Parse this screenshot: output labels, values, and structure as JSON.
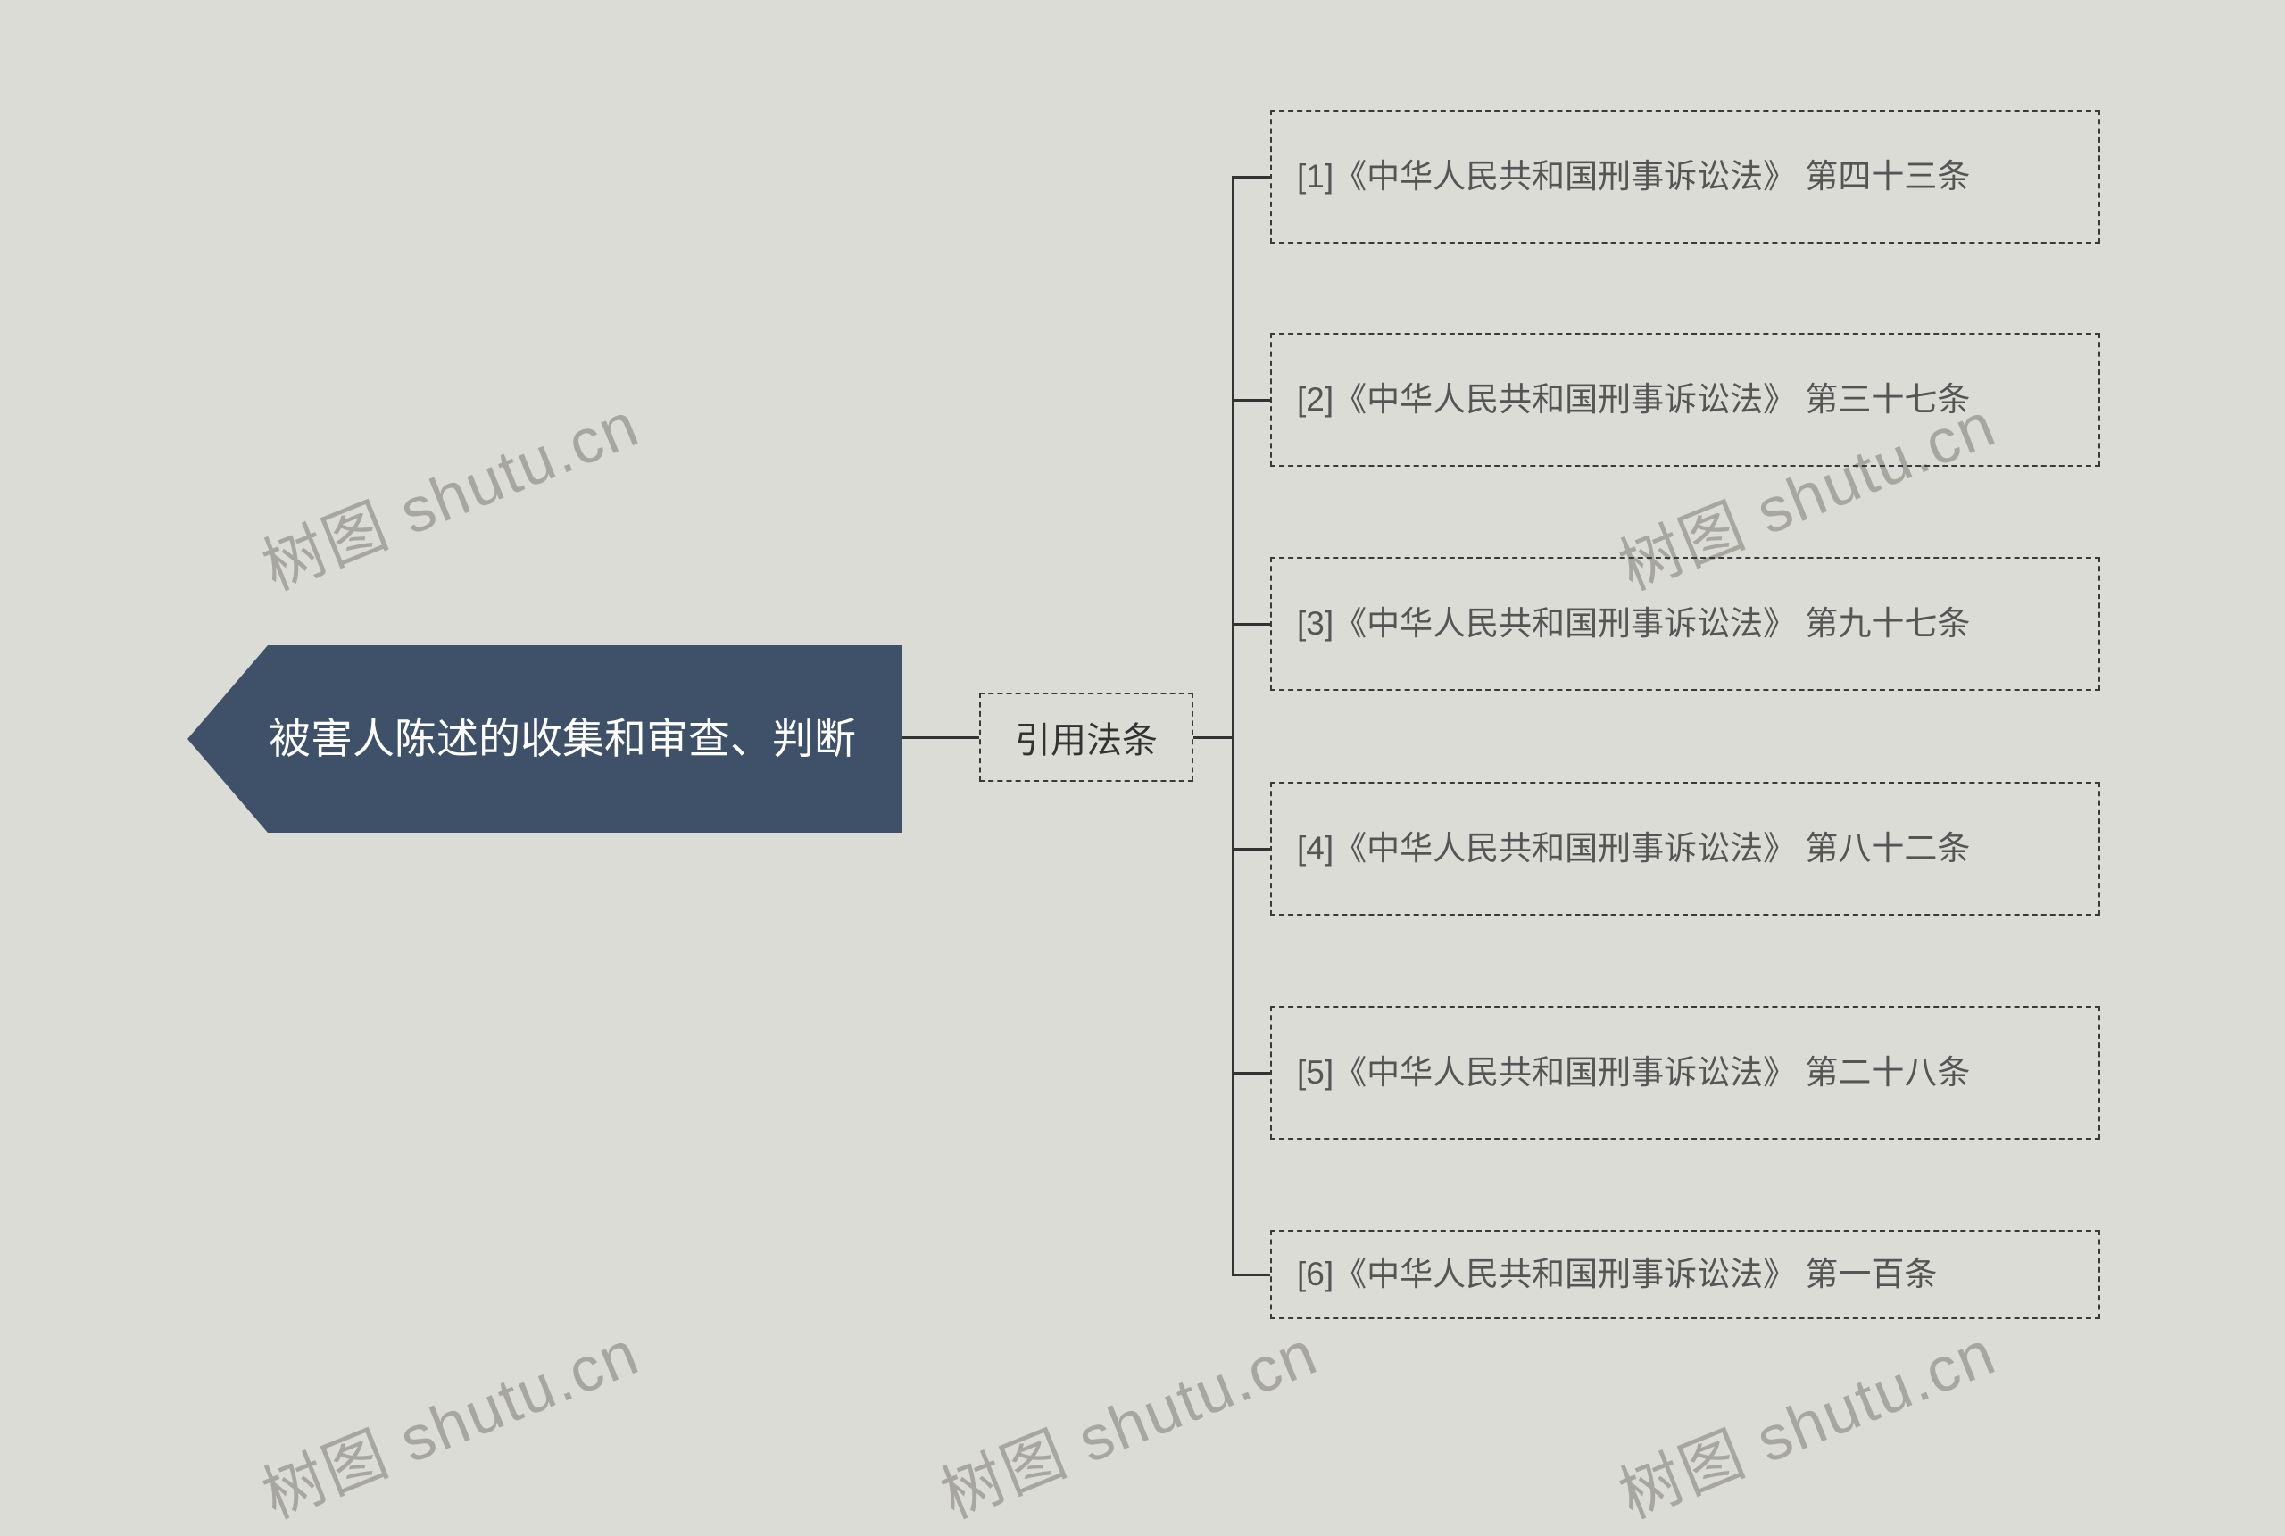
{
  "watermark_text": "树图 shutu.cn",
  "root": {
    "title": "被害人陈述的收集和审查、判断"
  },
  "sub": {
    "label": "引用法条"
  },
  "leaves": [
    {
      "text": "[1]《中华人民共和国刑事诉讼法》 第四十三条"
    },
    {
      "text": "[2]《中华人民共和国刑事诉讼法》 第三十七条"
    },
    {
      "text": "[3]《中华人民共和国刑事诉讼法》 第九十七条"
    },
    {
      "text": "[4]《中华人民共和国刑事诉讼法》 第八十二条"
    },
    {
      "text": "[5]《中华人民共和国刑事诉讼法》 第二十八条"
    },
    {
      "text": "[6]《中华人民共和国刑事诉讼法》 第一百条"
    }
  ],
  "colors": {
    "background": "#dcdcd7",
    "root_bg": "#3e5168",
    "root_text": "#ffffff",
    "node_border": "#3a3a3a",
    "leaf_text": "#555555",
    "watermark": "#a7a79f"
  }
}
